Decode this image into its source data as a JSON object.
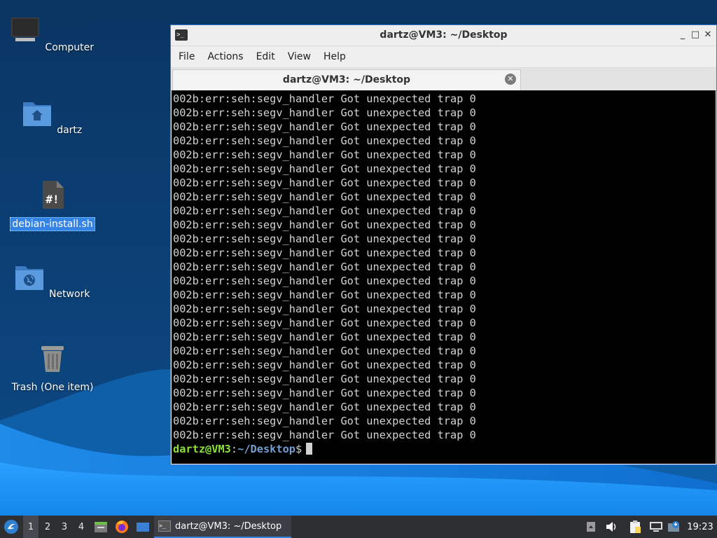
{
  "desktop": {
    "icons": [
      {
        "label": "Computer",
        "icon": "computer-icon"
      },
      {
        "label": "dartz",
        "icon": "home-folder-icon"
      },
      {
        "label": "debian-install.sh",
        "icon": "shell-script-icon",
        "selected": true
      },
      {
        "label": "Network",
        "icon": "network-folder-icon"
      },
      {
        "label": "Trash (One item)",
        "icon": "trash-icon"
      }
    ]
  },
  "window": {
    "title": "dartz@VM3: ~/Desktop",
    "controls": {
      "minimize": "_",
      "maximize": "□",
      "close": "✕"
    },
    "menu": [
      "File",
      "Actions",
      "Edit",
      "View",
      "Help"
    ],
    "tab": {
      "label": "dartz@VM3: ~/Desktop",
      "close": "✕"
    }
  },
  "terminal": {
    "lines": [
      "002b:err:seh:segv_handler Got unexpected trap 0",
      "002b:err:seh:segv_handler Got unexpected trap 0",
      "002b:err:seh:segv_handler Got unexpected trap 0",
      "002b:err:seh:segv_handler Got unexpected trap 0",
      "002b:err:seh:segv_handler Got unexpected trap 0",
      "002b:err:seh:segv_handler Got unexpected trap 0",
      "002b:err:seh:segv_handler Got unexpected trap 0",
      "002b:err:seh:segv_handler Got unexpected trap 0",
      "002b:err:seh:segv_handler Got unexpected trap 0",
      "002b:err:seh:segv_handler Got unexpected trap 0",
      "002b:err:seh:segv_handler Got unexpected trap 0",
      "002b:err:seh:segv_handler Got unexpected trap 0",
      "002b:err:seh:segv_handler Got unexpected trap 0",
      "002b:err:seh:segv_handler Got unexpected trap 0",
      "002b:err:seh:segv_handler Got unexpected trap 0",
      "002b:err:seh:segv_handler Got unexpected trap 0",
      "002b:err:seh:segv_handler Got unexpected trap 0",
      "002b:err:seh:segv_handler Got unexpected trap 0",
      "002b:err:seh:segv_handler Got unexpected trap 0",
      "002b:err:seh:segv_handler Got unexpected trap 0",
      "002b:err:seh:segv_handler Got unexpected trap 0",
      "002b:err:seh:segv_handler Got unexpected trap 0",
      "002b:err:seh:segv_handler Got unexpected trap 0",
      "002b:err:seh:segv_handler Got unexpected trap 0",
      "002b:err:seh:segv_handler Got unexpected trap 0"
    ],
    "prompt": {
      "user_host": "dartz@VM3",
      "separator": ":",
      "path": "~/Desktop",
      "symbol": "$"
    }
  },
  "taskbar": {
    "workspaces": [
      "1",
      "2",
      "3",
      "4"
    ],
    "active_workspace": "1",
    "task_label": "dartz@VM3: ~/Desktop",
    "clock": "19:23"
  },
  "colors": {
    "prompt_user": "#8ae234",
    "prompt_path": "#729fcf",
    "terminal_bg": "#000000",
    "terminal_fg": "#d3d3d3",
    "selection": "#3584e4",
    "taskbar_bg": "#2d2f33"
  }
}
